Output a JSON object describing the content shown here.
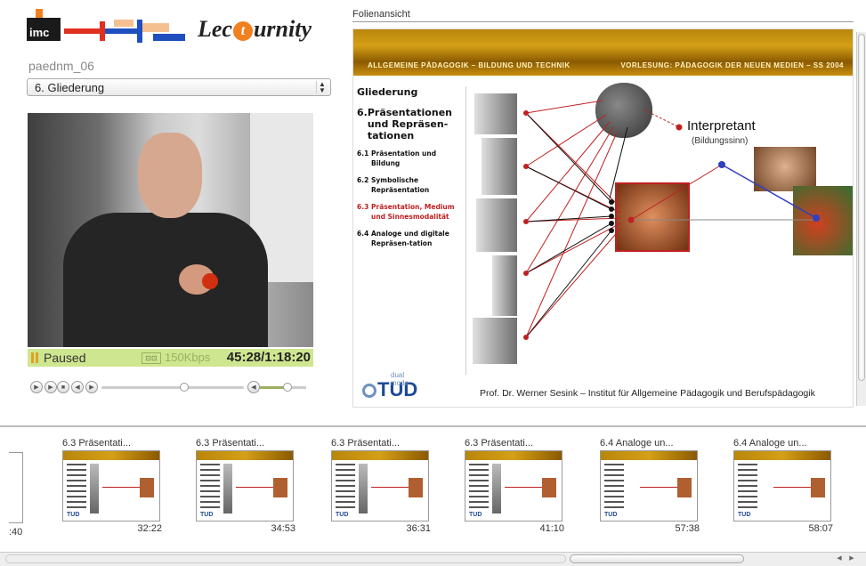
{
  "app": {
    "logo_company": "imc",
    "logo_product_pre": "Lec",
    "logo_product_mid": "t",
    "logo_product_post": "urnity",
    "lecture_id": "paednm_06",
    "chapter_selected": "6. Gliederung"
  },
  "player": {
    "status": "Paused",
    "bitrate": "150Kbps",
    "time": "45:28/1:18:20",
    "seek_progress": 0.58,
    "volume_level": 0.6
  },
  "slide_panel": {
    "title": "Folienansicht",
    "header_left": "ALLGEMEINE PÄDAGOGIK – BILDUNG UND TECHNIK",
    "header_right": "VORLESUNG: PÄDAGOGIK DER NEUEN MEDIEN – SS 2004",
    "toc_heading": "Gliederung",
    "toc_main_num": "6.",
    "toc_main_text": "Präsentationen und Repräsen-tationen",
    "toc_items": [
      {
        "num": "6.1",
        "text": "Präsentation und Bildung"
      },
      {
        "num": "6.2",
        "text": "Symbolische Repräsentation"
      },
      {
        "num": "6.3",
        "text": "Präsentation, Medium und Sinnesmodalität"
      },
      {
        "num": "6.4",
        "text": "Analoge und digitale Repräsen-tation"
      }
    ],
    "interpretant": "Interpretant",
    "interpretant_sub": "(Bildungssinn)",
    "logo": "TUD",
    "logo_sub": "dual mode",
    "footer": "Prof. Dr. Werner Sesink – Institut für Allgemeine Pädagogik und Berufspädagogik"
  },
  "thumbnails": {
    "partial_time": ":40",
    "items": [
      {
        "title": "6.3 Präsentati...",
        "time": "32:22"
      },
      {
        "title": "6.3 Präsentati...",
        "time": "34:53"
      },
      {
        "title": "6.3 Präsentati...",
        "time": "36:31"
      },
      {
        "title": "6.3 Präsentati...",
        "time": "41:10"
      },
      {
        "title": "6.4 Analoge un...",
        "time": "57:38"
      },
      {
        "title": "6.4 Analoge un...",
        "time": "58:07"
      }
    ]
  },
  "colors": {
    "status_bar": "#cfe690",
    "accent_orange": "#f08020",
    "active_toc": "#c02020",
    "tud_blue": "#1d4a9a"
  },
  "icons": [
    "pause-icon",
    "fullscreen-icon",
    "play-icon",
    "stop-icon",
    "rewind-icon",
    "forward-icon",
    "volume-icon",
    "select-arrows-icon"
  ]
}
